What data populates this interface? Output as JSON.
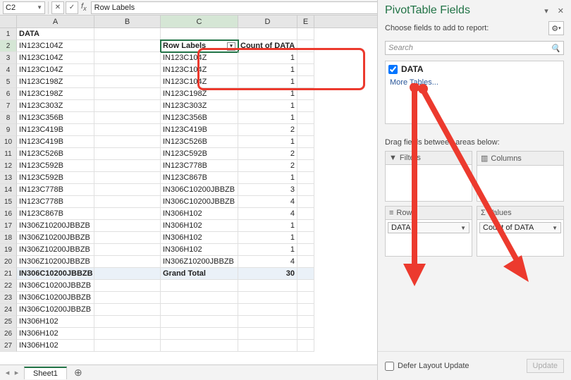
{
  "namebox": {
    "cellref": "C2",
    "formula": "Row Labels"
  },
  "columns": [
    "A",
    "B",
    "C",
    "D",
    "E"
  ],
  "selected_col": "C",
  "selected_row": 2,
  "colA_header": "DATA",
  "colA_values": [
    "IN123C104Z",
    "IN123C104Z",
    "IN123C104Z",
    "IN123C198Z",
    "IN123C198Z",
    "IN123C303Z",
    "IN123C356B",
    "IN123C419B",
    "IN123C419B",
    "IN123C526B",
    "IN123C592B",
    "IN123C592B",
    "IN123C778B",
    "IN123C778B",
    "IN123C867B",
    "IN306Z10200JBBZB",
    "IN306Z10200JBBZB",
    "IN306Z10200JBBZB",
    "IN306Z10200JBBZB",
    "IN306C10200JBBZB",
    "IN306C10200JBBZB",
    "IN306C10200JBBZB",
    "IN306C10200JBBZB",
    "IN306H102",
    "IN306H102",
    "IN306H102"
  ],
  "pivot": {
    "row_header": "Row Labels",
    "val_header": "Count of DATA",
    "rows": [
      {
        "label": "IN123C104Z",
        "count": 1
      },
      {
        "label": "IN123C104Z",
        "count": 1
      },
      {
        "label": "IN123C104Z",
        "count": 1
      },
      {
        "label": "IN123C198Z",
        "count": 1
      },
      {
        "label": "IN123C303Z",
        "count": 1
      },
      {
        "label": "IN123C356B",
        "count": 1
      },
      {
        "label": "IN123C419B",
        "count": 2
      },
      {
        "label": "IN123C526B",
        "count": 1
      },
      {
        "label": "IN123C592B",
        "count": 2
      },
      {
        "label": "IN123C778B",
        "count": 2
      },
      {
        "label": "IN123C867B",
        "count": 1
      },
      {
        "label": "IN306C10200JBBZB",
        "count": 3
      },
      {
        "label": "IN306C10200JBBZB",
        "count": 4
      },
      {
        "label": "IN306H102",
        "count": 4
      },
      {
        "label": "IN306H102",
        "count": 1
      },
      {
        "label": "IN306H102",
        "count": 1
      },
      {
        "label": "IN306H102",
        "count": 1
      },
      {
        "label": "IN306Z10200JBBZB",
        "count": 4
      }
    ],
    "total_label": "Grand Total",
    "total_value": 30
  },
  "sheet": {
    "active": "Sheet1"
  },
  "pane": {
    "title": "PivotTable Fields",
    "subtitle": "Choose fields to add to report:",
    "search_placeholder": "Search",
    "field_name": "DATA",
    "more_tables": "More Tables...",
    "drag_label": "Drag fields between areas below:",
    "filters": "Filters",
    "columns": "Columns",
    "rows_lbl": "Rows",
    "values_lbl": "Values",
    "row_chip": "DATA",
    "val_chip": "Count of DATA",
    "defer": "Defer Layout Update",
    "update": "Update"
  }
}
